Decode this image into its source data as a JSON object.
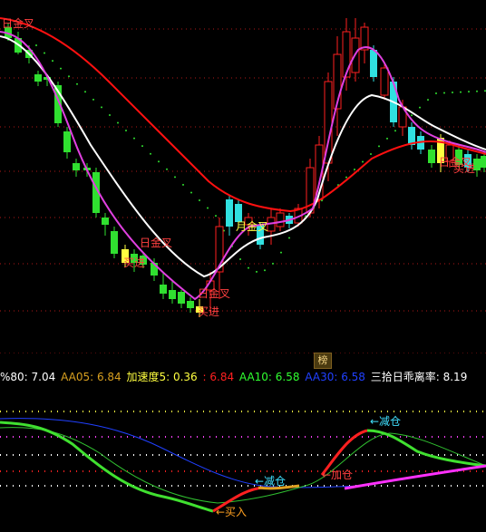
{
  "main_labels": {
    "top_left": "日金叉",
    "golden_cross_1": "日金叉",
    "buy_a": "买进",
    "golden_cross_2": "日金叉",
    "monthly_cross": "月金叉",
    "fast_cross": "日金叉",
    "buy_b": "买进",
    "buy_c": "买进"
  },
  "tab_label": "榜",
  "indicators": [
    {
      "label": "%80:",
      "value": "7.04",
      "color": "#ffffff"
    },
    {
      "label": "AA05:",
      "value": "6.84",
      "color": "#d8a020"
    },
    {
      "label": "加速度5:",
      "value": "0.36",
      "color": "#ffff40"
    },
    {
      "label": ":",
      "value": "6.84",
      "color": "#ff2020"
    },
    {
      "label": "AA10:",
      "value": "6.58",
      "color": "#30ff30"
    },
    {
      "label": "AA30:",
      "value": "6.58",
      "color": "#2040ff"
    },
    {
      "label": "三拾日乖离率:",
      "value": "8.19",
      "color": "#ffffff"
    }
  ],
  "sub_labels": {
    "reduce_top": "←减仓",
    "reduce_low": "←减仓",
    "add": "←加仓",
    "buy": "←买入"
  },
  "colors": {
    "up": "#ff2020",
    "down_green": "#30e030",
    "down_cyan": "#30e0e0",
    "ma_white": "#ffffff",
    "ma_magenta": "#e040e0",
    "ma_red": "#ff1010",
    "grid_red": "#c01010"
  }
}
